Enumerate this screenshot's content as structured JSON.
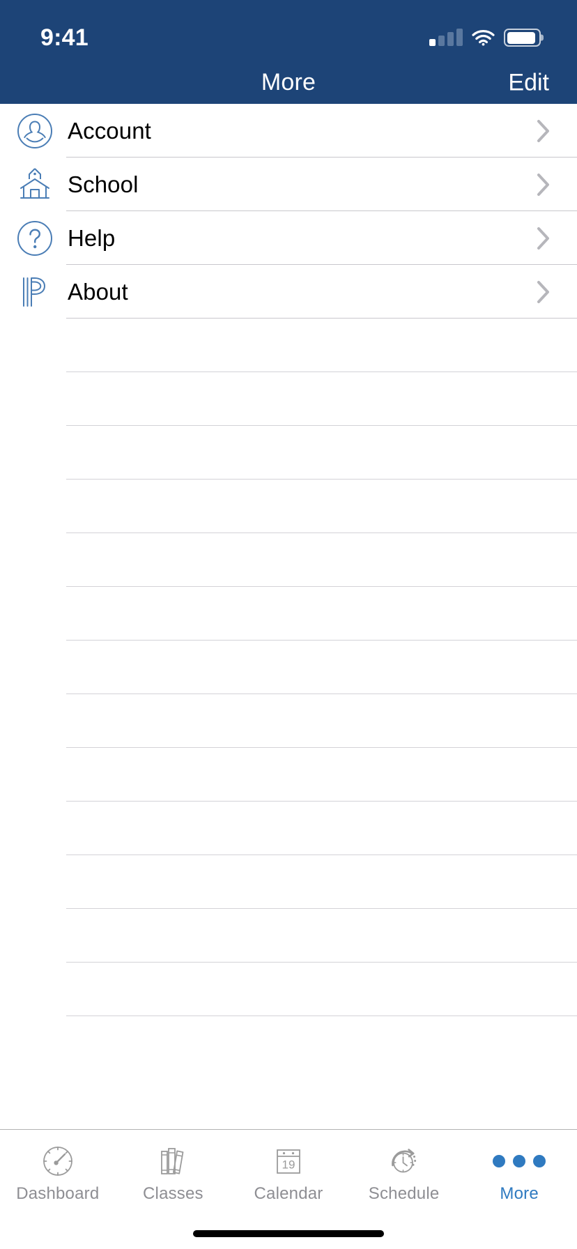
{
  "status_bar": {
    "time": "9:41",
    "cellular_icon": "cellular-signal-icon",
    "wifi_icon": "wifi-icon",
    "battery_icon": "battery-icon"
  },
  "navbar": {
    "title": "More",
    "edit_label": "Edit",
    "background_color": "#1d4477",
    "text_color": "#ffffff"
  },
  "list": {
    "accent_color": "#4a7db5",
    "separator_color": "#c8c7cc",
    "items": [
      {
        "label": "Account",
        "icon": "account-person-circle-icon",
        "chevron": "chevron-right-icon"
      },
      {
        "label": "School",
        "icon": "schoolhouse-icon",
        "chevron": "chevron-right-icon"
      },
      {
        "label": "Help",
        "icon": "question-mark-circle-icon",
        "chevron": "chevron-right-icon"
      },
      {
        "label": "About",
        "icon": "powerschool-p-logo-icon",
        "chevron": "chevron-right-icon"
      }
    ],
    "empty_row_count": 13
  },
  "tab_bar": {
    "active_color": "#2f7ac0",
    "inactive_color": "#8e8e93",
    "tabs": [
      {
        "label": "Dashboard",
        "icon": "gauge-icon",
        "active": false
      },
      {
        "label": "Classes",
        "icon": "books-icon",
        "active": false
      },
      {
        "label": "Calendar",
        "icon": "calendar-icon",
        "active": false,
        "day": "19"
      },
      {
        "label": "Schedule",
        "icon": "clock-arrow-icon",
        "active": false
      },
      {
        "label": "More",
        "icon": "ellipsis-icon",
        "active": true
      }
    ]
  },
  "home_indicator": {
    "name": "home-indicator"
  }
}
